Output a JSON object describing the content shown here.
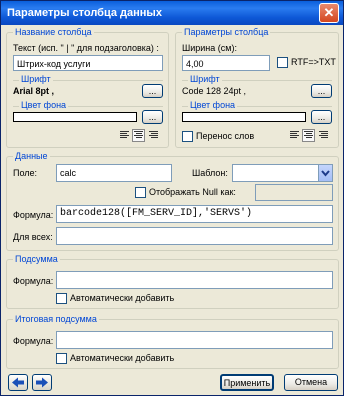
{
  "window": {
    "title": "Параметры столбца данных",
    "close": "✕"
  },
  "column_name": {
    "legend": "Название столбца",
    "text_label": "Текст (исп. \" | \" для подзаголовка) :",
    "text_value": "Штрих-код услуги",
    "font_legend": "Шрифт",
    "font_value": "Arial 8pt ,",
    "bg_legend": "Цвет фона",
    "browse": "..."
  },
  "column_params": {
    "legend": "Параметры столбца",
    "width_label": "Ширина (см):",
    "width_value": "4,00",
    "rtf_label": "RTF=>TXT",
    "font_legend": "Шрифт",
    "font_value": "Code 128 24pt ,",
    "bg_legend": "Цвет фона",
    "wrap_label": "Перенос слов",
    "browse": "..."
  },
  "data": {
    "legend": "Данные",
    "field_label": "Поле:",
    "field_value": "calc",
    "template_label": "Шаблон:",
    "template_value": "",
    "show_null_label": "Отображать Null как:",
    "formula_label": "Формула:",
    "formula_value": "barcode128([FM_SERV_ID],'SERVS')",
    "for_all_label": "Для всех:",
    "for_all_value": ""
  },
  "subtotal": {
    "legend": "Подсумма",
    "formula_label": "Формула:",
    "auto_add_label": "Автоматически добавить"
  },
  "total": {
    "legend": "Итоговая подсумма",
    "formula_label": "Формула:",
    "auto_add_label": "Автоматически добавить"
  },
  "footer": {
    "apply_label": "Применить",
    "cancel_label": "Отмена"
  },
  "icons": [
    "arrow-left-icon",
    "arrow-right-icon",
    "align-left-icon",
    "align-center-icon",
    "align-right-icon",
    "dropdown-arrow-icon",
    "close-icon"
  ],
  "colors": {
    "titlebar": "#0a5fdc",
    "legend_text": "#0046d5",
    "dialog_bg": "#ece9d8"
  }
}
